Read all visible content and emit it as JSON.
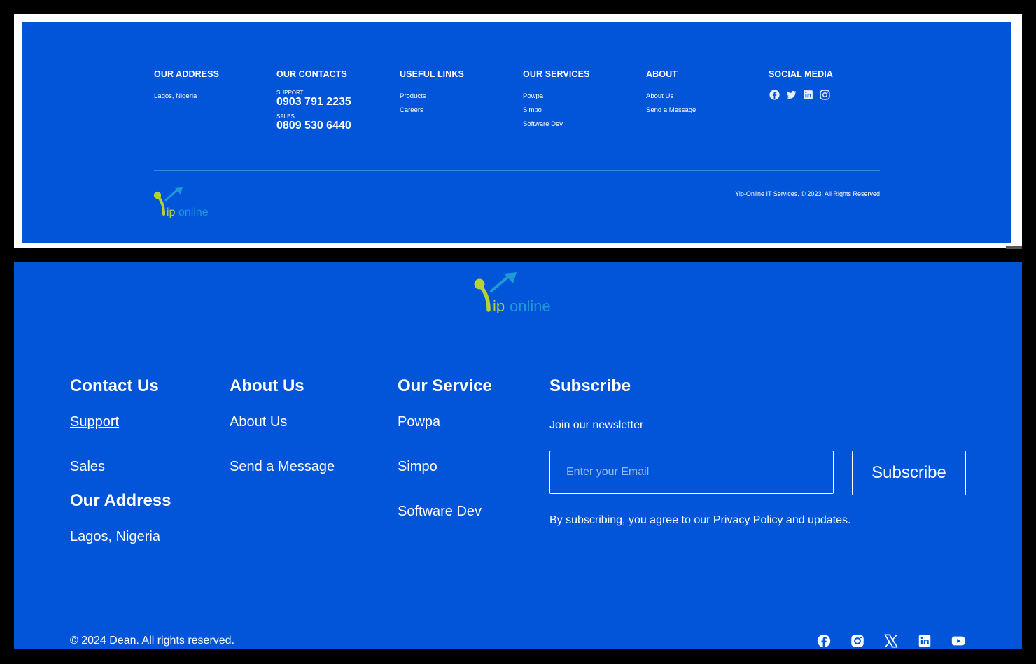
{
  "top_footer": {
    "address": {
      "heading": "OUR ADDRESS",
      "text": "Lagos, Nigeria"
    },
    "contacts": {
      "heading": "OUR CONTACTS",
      "support_label": "SUPPORT",
      "support_number": "0903 791 2235",
      "sales_label": "SALES",
      "sales_number": "0809 530 6440"
    },
    "useful_links": {
      "heading": "USEFUL LINKS",
      "items": [
        "Products",
        "Careers"
      ]
    },
    "services": {
      "heading": "OUR SERVICES",
      "items": [
        "Powpa",
        "Simpo",
        "Software Dev"
      ]
    },
    "about": {
      "heading": "ABOUT",
      "items": [
        "About Us",
        "Send a Message"
      ]
    },
    "social": {
      "heading": "SOCIAL MEDIA",
      "icons": [
        "facebook-icon",
        "twitter-icon",
        "linkedin-icon",
        "instagram-icon"
      ]
    },
    "copyright": "Yip-Online IT Services. © 2023. All Rights Reserved",
    "logo": {
      "y": "Y",
      "ip": "ip",
      "online": "online"
    }
  },
  "bottom_footer": {
    "logo": {
      "y": "Y",
      "ip": "ip",
      "online": "online"
    },
    "contact": {
      "heading": "Contact Us",
      "items": [
        "Support",
        "Sales"
      ]
    },
    "address": {
      "heading": "Our Address",
      "text": "Lagos, Nigeria"
    },
    "about": {
      "heading": "About Us",
      "items": [
        "About Us",
        "Send a Message"
      ]
    },
    "service": {
      "heading": "Our Service",
      "items": [
        "Powpa",
        "Simpo",
        "Software Dev"
      ]
    },
    "subscribe": {
      "heading": "Subscribe",
      "text": "Join our newsletter",
      "placeholder": "Enter your Email",
      "button": "Subscribe",
      "terms": "By subscribing, you agree to our Privacy Policy and updates."
    },
    "copyright": "© 2024 Dean. All rights reserved.",
    "social_icons": [
      "facebook-icon",
      "instagram-icon",
      "x-icon",
      "linkedin-icon",
      "youtube-icon"
    ]
  },
  "colors": {
    "brand_blue": "#0254d8",
    "logo_green": "#b5d334",
    "logo_teal": "#1e9ad6"
  }
}
